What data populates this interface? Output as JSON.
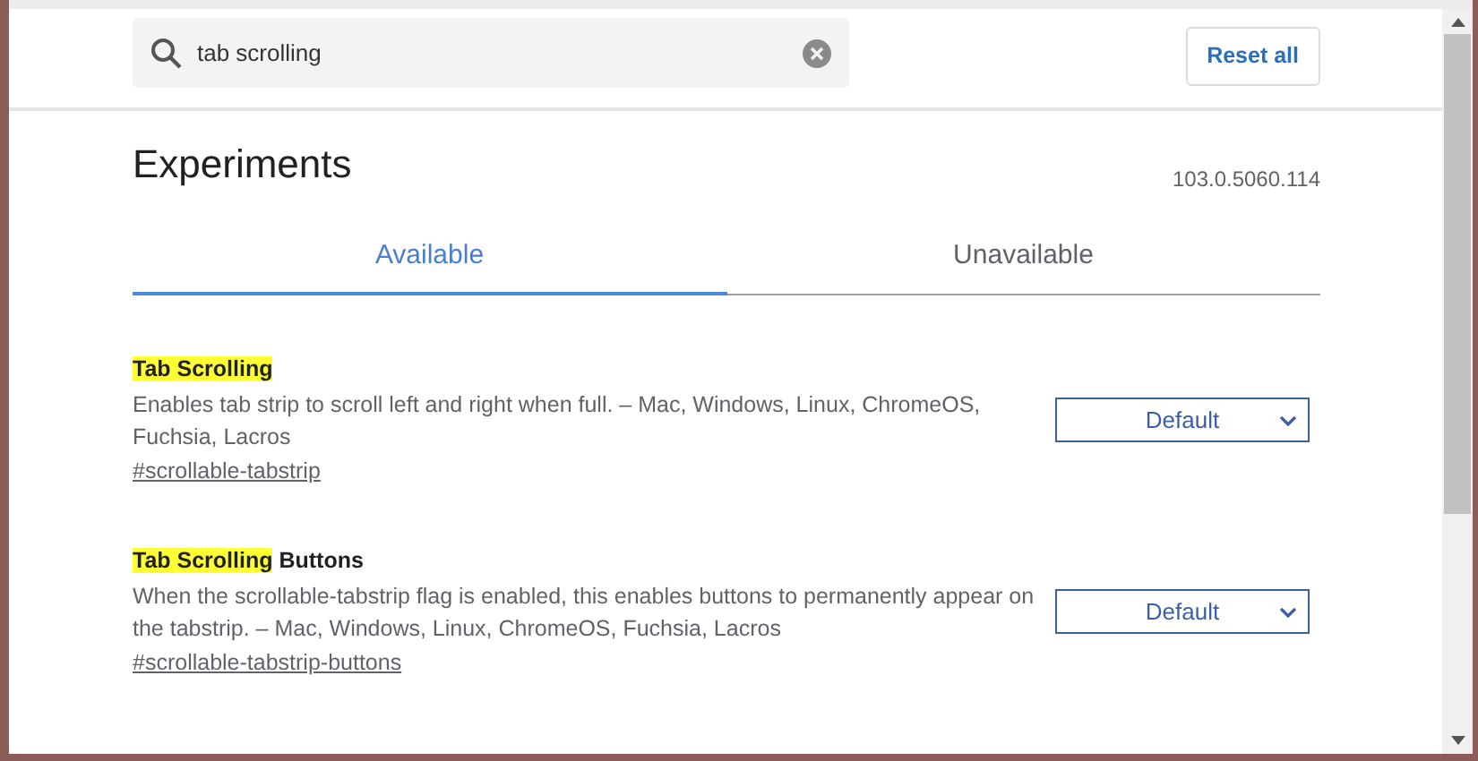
{
  "search": {
    "value": "tab scrolling"
  },
  "reset_button": "Reset all",
  "heading": "Experiments",
  "version": "103.0.5060.114",
  "tabs": [
    {
      "label": "Available",
      "selected": true
    },
    {
      "label": "Unavailable",
      "selected": false
    }
  ],
  "flags": [
    {
      "title": [
        {
          "text": "Tab Scrolling",
          "highlighted": true
        }
      ],
      "description": "Enables tab strip to scroll left and right when full. – Mac, Windows, Linux, ChromeOS, Fuchsia, Lacros",
      "link": "#scrollable-tabstrip",
      "value": "Default"
    },
    {
      "title": [
        {
          "text": "Tab Scrolling",
          "highlighted": true
        },
        {
          "text": " Buttons",
          "highlighted": false
        }
      ],
      "description": "When the scrollable-tabstrip flag is enabled, this enables buttons to permanently appear on the tabstrip. – Mac, Windows, Linux, ChromeOS, Fuchsia, Lacros",
      "link": "#scrollable-tabstrip-buttons",
      "value": "Default"
    }
  ]
}
